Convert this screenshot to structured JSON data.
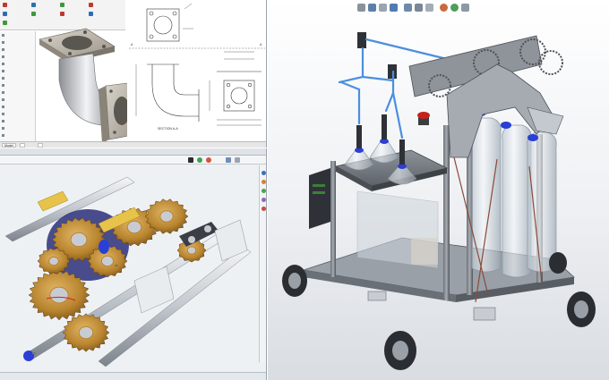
{
  "drawing_window": {
    "ribbon_buttons": [
      "",
      "",
      "",
      "",
      "",
      "",
      "",
      "",
      ""
    ],
    "tree_items": [
      "",
      "",
      "",
      "",
      "",
      "",
      "",
      "",
      "",
      "",
      "",
      "",
      "",
      "",
      ""
    ],
    "view_labels": {
      "section": "SECTION A-A",
      "a_top": "A",
      "a_bottom": "A"
    },
    "tabs": [
      "Model",
      "",
      ""
    ]
  },
  "gears_window": {
    "title": "",
    "callouts": [
      "",
      ""
    ],
    "status_text": ""
  },
  "colors": {
    "gear_bronze": "#b8842e",
    "axle_grey": "#c8ccd2",
    "sleeve_yellow": "#e8c34a",
    "accent_blue": "#2a3fd6",
    "frame_grey": "#55595f",
    "bottle_glass": "#c9d3dc",
    "tube_blue": "#4a8fe0",
    "estop_red": "#c4221c"
  }
}
